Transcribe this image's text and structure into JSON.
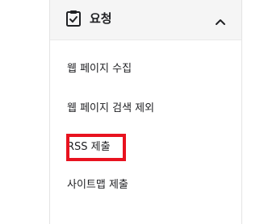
{
  "section": {
    "title": "요청",
    "icon": "clipboard-check-icon",
    "chevron_icon": "chevron-up-icon",
    "expanded": true
  },
  "menu": {
    "items": [
      {
        "label": "웹 페이지 수집"
      },
      {
        "label": "웹 페이지 검색 제외"
      },
      {
        "label": "RSS 제출",
        "highlighted": true
      },
      {
        "label": "사이트맵 제출"
      }
    ]
  },
  "colors": {
    "header_bg": "#f5f5f5",
    "text": "#202124",
    "highlight": "#e8121f",
    "border": "#e4e4e4"
  }
}
